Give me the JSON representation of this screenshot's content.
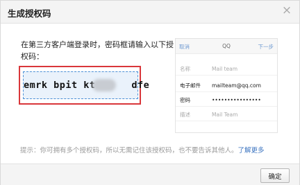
{
  "dialog": {
    "title": "生成授权码",
    "close_glyph": "×"
  },
  "instruction": "在第三方客户端登录时，密码框请输入以下授权码：",
  "auth_code": {
    "prefix": "emrk bpit kt",
    "suffix": "dfe"
  },
  "phone": {
    "cancel": "取消",
    "title": "QQ",
    "next": "下一步",
    "rows": [
      {
        "label": "名称",
        "value": "Mail team",
        "emphasis": false
      },
      {
        "label": "电子邮件",
        "value": "mailteam@qq.com",
        "emphasis": true
      },
      {
        "label": "密码",
        "value": "••••••••••••••••",
        "emphasis": true
      },
      {
        "label": "描述",
        "value": "Mail Team",
        "emphasis": false
      }
    ]
  },
  "tip": {
    "text": "提示：你可拥有多个授权码，所以无需记住该授权码，也不要告诉其他人。",
    "link": "了解更多"
  },
  "footer": {
    "confirm_label": "确定"
  },
  "colors": {
    "highlight_border": "#d9363a",
    "code_background": "#eaf2fb",
    "link": "#3c74c0"
  },
  "icons": {
    "close": "close-icon"
  }
}
